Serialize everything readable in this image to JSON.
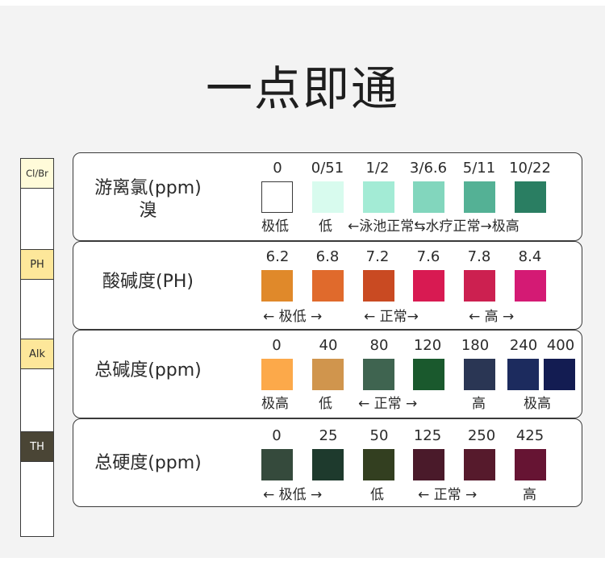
{
  "title": "一点即通",
  "strip": {
    "pads": [
      {
        "label": "Cl/Br",
        "color": "#fffbd9"
      },
      {
        "label": "PH",
        "color": "#fde79a"
      },
      {
        "label": "Alk",
        "color": "#fde79a"
      },
      {
        "label": "TH",
        "color": "#4a4535"
      }
    ]
  },
  "rows": [
    {
      "label": "游离氯(ppm)",
      "sublabel": "溴",
      "values": [
        "0",
        "0/51",
        "1/2",
        "3/6.6",
        "5/11",
        "10/22"
      ],
      "colors": [
        "#ffffff",
        "#d8fbee",
        "#a3ebd5",
        "#82d6bd",
        "#54b195",
        "#2a7e62"
      ],
      "descriptions": [
        "极低",
        "低",
        "←泳池正常⇆水疗正常→极高"
      ]
    },
    {
      "label": "酸碱度(PH)",
      "values": [
        "6.2",
        "6.8",
        "7.2",
        "7.6",
        "7.8",
        "8.4"
      ],
      "colors": [
        "#e0892a",
        "#e06a2c",
        "#c94a22",
        "#d81a52",
        "#cc2050",
        "#d41a74"
      ],
      "descriptions": [
        "← 极低 →",
        "← 正常→",
        "← 高 →"
      ]
    },
    {
      "label": "总碱度(ppm)",
      "values": [
        "0",
        "40",
        "80",
        "120",
        "180",
        "240",
        "400"
      ],
      "colors": [
        "#fca94a",
        "#d0954d",
        "#3f6450",
        "#1a592d",
        "#2a3654",
        "#1c2b5e",
        "#131c52"
      ],
      "descriptions": [
        "极高",
        "低",
        "← 正常 →",
        "高",
        "极高"
      ]
    },
    {
      "label": "总硬度(ppm)",
      "values": [
        "0",
        "25",
        "50",
        "125",
        "250",
        "425"
      ],
      "colors": [
        "#354a3c",
        "#1e3a2d",
        "#333f20",
        "#4a1a2a",
        "#561a2c",
        "#661433"
      ],
      "descriptions": [
        "← 极低 →",
        "低",
        "← 正常 →",
        "高"
      ]
    }
  ]
}
